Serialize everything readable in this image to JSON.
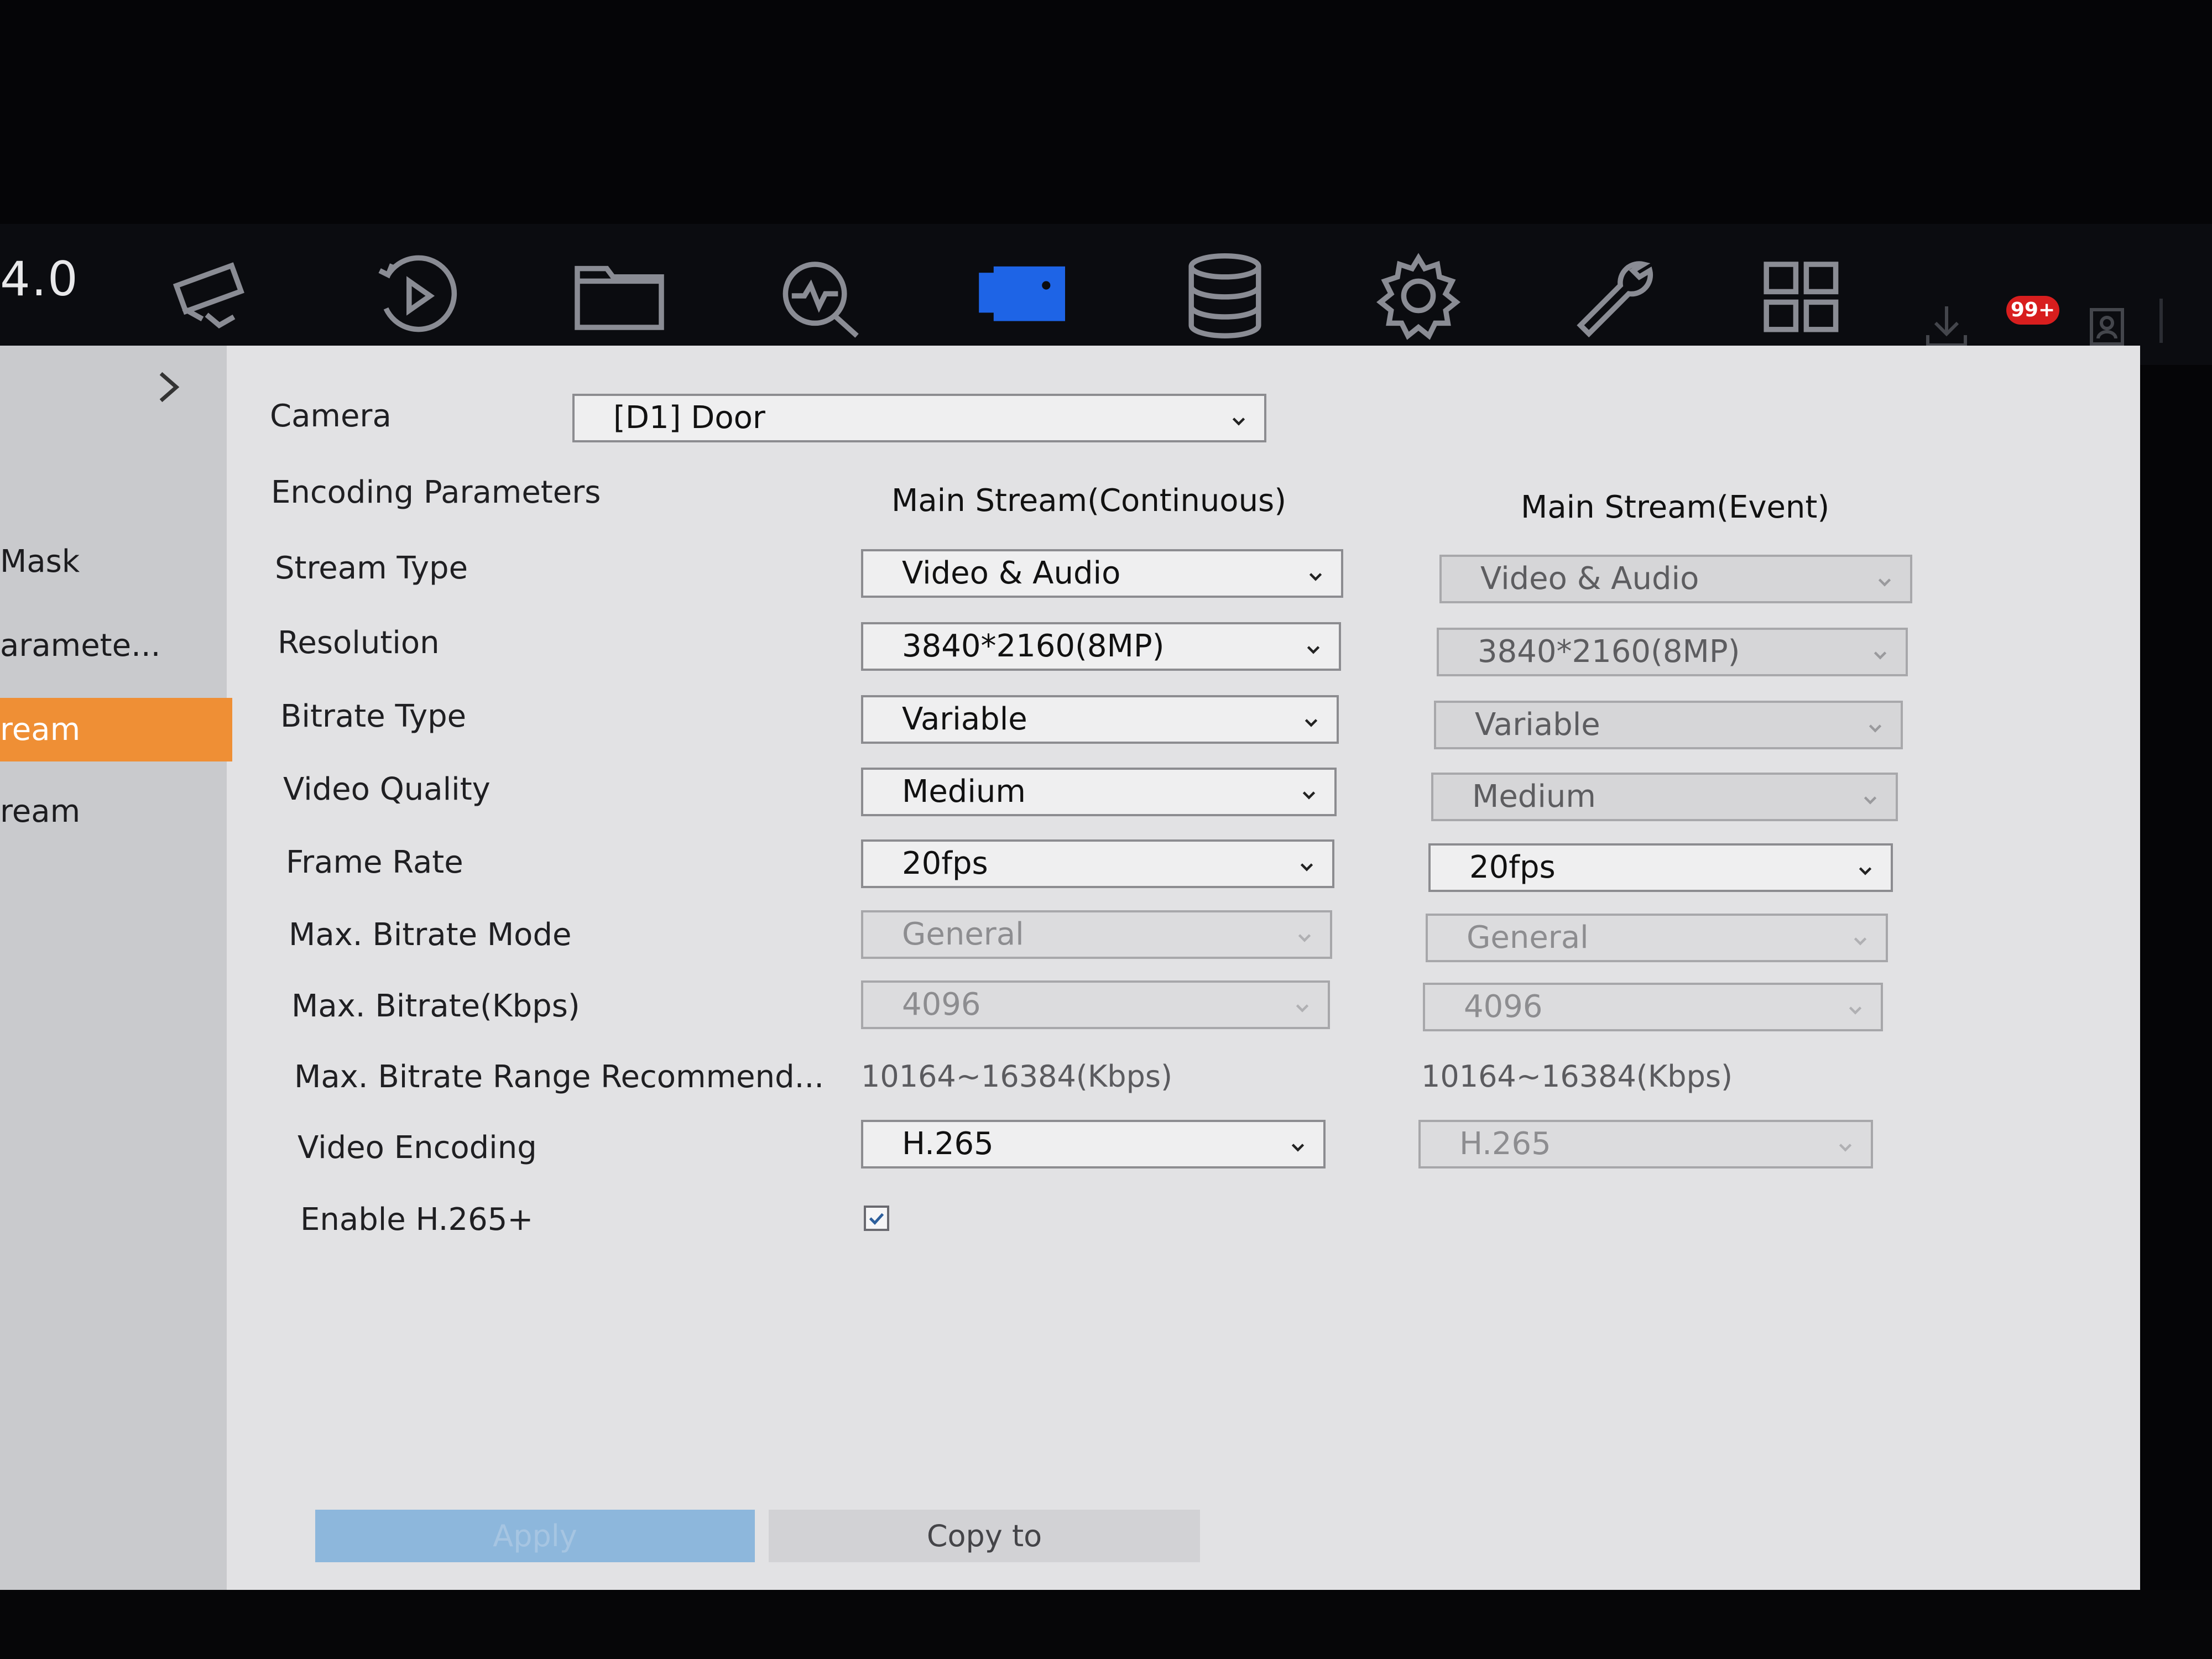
{
  "toolbar": {
    "version": "4.0",
    "icons": [
      "camera-icon",
      "playback-icon",
      "folder-icon",
      "analytics-icon",
      "video-record-icon",
      "storage-icon",
      "settings-icon",
      "maintenance-icon",
      "layout-grid-icon",
      "download-icon",
      "alarm-icon",
      "user-icon"
    ],
    "badge": "99+",
    "active_color": "#1e64e6"
  },
  "sidebar": {
    "items": [
      {
        "label": "Mask"
      },
      {
        "label": "aramete..."
      },
      {
        "label": "ream"
      },
      {
        "label": "ream"
      }
    ],
    "active_color": "#ef8f35"
  },
  "form": {
    "camera_label": "Camera",
    "camera_value": "[D1] Door",
    "encoding_label": "Encoding Parameters",
    "col_main_continuous": "Main Stream(Continuous)",
    "col_main_event": "Main Stream(Event)",
    "rows": [
      {
        "label": "Stream Type",
        "continuous": "Video & Audio",
        "event": "Video & Audio"
      },
      {
        "label": "Resolution",
        "continuous": "3840*2160(8MP)",
        "event": "3840*2160(8MP)"
      },
      {
        "label": "Bitrate Type",
        "continuous": "Variable",
        "event": "Variable"
      },
      {
        "label": "Video Quality",
        "continuous": "Medium",
        "event": "Medium"
      },
      {
        "label": "Frame Rate",
        "continuous": "20fps",
        "event": "20fps"
      },
      {
        "label": "Max. Bitrate Mode",
        "continuous": "General",
        "event": "General"
      },
      {
        "label": "Max. Bitrate(Kbps)",
        "continuous": "4096",
        "event": "4096"
      },
      {
        "label": "Max. Bitrate Range Recommend...",
        "continuous": "10164~16384(Kbps)",
        "event": "10164~16384(Kbps)"
      },
      {
        "label": "Video Encoding",
        "continuous": "H.265",
        "event": "H.265"
      },
      {
        "label": "Enable H.265+"
      }
    ],
    "enable_h265plus_checked": true
  },
  "buttons": {
    "apply": "Apply",
    "copy_to": "Copy to"
  }
}
